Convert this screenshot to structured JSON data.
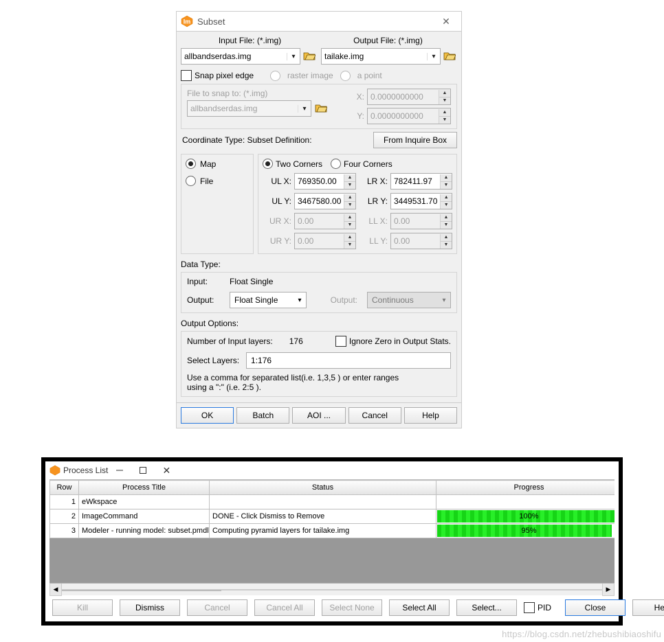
{
  "subset": {
    "title": "Subset",
    "inputFile": {
      "label": "Input File: (*.img)",
      "value": "allbandserdas.img"
    },
    "outputFile": {
      "label": "Output File: (*.img)",
      "value": "tailake.img"
    },
    "snap": {
      "label": "Snap pixel edge",
      "options": {
        "raster": "raster image",
        "point": "a point"
      }
    },
    "snapFile": {
      "label": "File to snap to: (*.img)",
      "value": "allbandserdas.img"
    },
    "snapX": {
      "label": "X:",
      "value": "0.0000000000"
    },
    "snapY": {
      "label": "Y:",
      "value": "0.0000000000"
    },
    "coordLine": "Coordinate Type: Subset Definition:",
    "fromInquire": "From Inquire Box",
    "coordType": {
      "map": "Map",
      "file": "File"
    },
    "cornerMode": {
      "two": "Two Corners",
      "four": "Four Corners"
    },
    "coords": {
      "ulx": {
        "label": "UL X:",
        "value": "769350.00"
      },
      "lrx": {
        "label": "LR X:",
        "value": "782411.97"
      },
      "uly": {
        "label": "UL Y:",
        "value": "3467580.00"
      },
      "lry": {
        "label": "LR Y:",
        "value": "3449531.70"
      },
      "urx": {
        "label": "UR X:",
        "value": "0.00"
      },
      "llx": {
        "label": "LL X:",
        "value": "0.00"
      },
      "ury": {
        "label": "UR Y:",
        "value": "0.00"
      },
      "lly": {
        "label": "LL Y:",
        "value": "0.00"
      }
    },
    "dataType": {
      "header": "Data Type:",
      "inputLabel": "Input:",
      "inputValue": "Float Single",
      "outputLabel": "Output:",
      "outputValue": "Float Single",
      "output2Label": "Output:",
      "output2Value": "Continuous"
    },
    "outputOptions": {
      "header": "Output Options:",
      "numLayersLabel": "Number of Input layers:",
      "numLayersValue": "176",
      "ignoreZero": "Ignore Zero in Output Stats.",
      "selectLayersLabel": "Select Layers:",
      "selectLayersValue": "1:176",
      "hint1": "Use a comma for separated list(i.e. 1,3,5 ) or enter ranges",
      "hint2": "using a \":\" (i.e. 2:5 )."
    },
    "buttons": {
      "ok": "OK",
      "batch": "Batch",
      "aoi": "AOI ...",
      "cancel": "Cancel",
      "help": "Help"
    }
  },
  "procList": {
    "title": "Process List",
    "columns": {
      "row": "Row",
      "title": "Process Title",
      "status": "Status",
      "progress": "Progress"
    },
    "rows": [
      {
        "n": "1",
        "title": "eWkspace",
        "status": "",
        "progress": null,
        "progressLabel": ""
      },
      {
        "n": "2",
        "title": "ImageCommand",
        "status": "DONE - Click Dismiss to Remove",
        "progress": 100,
        "progressLabel": "100%"
      },
      {
        "n": "3",
        "title": "Modeler - running model: subset.pmdl",
        "status": "Computing pyramid layers for tailake.img",
        "progress": 95,
        "progressLabel": "95%"
      }
    ],
    "buttons": {
      "kill": "Kill",
      "dismiss": "Dismiss",
      "cancel": "Cancel",
      "cancelAll": "Cancel All",
      "selectNone": "Select None",
      "selectAll": "Select All",
      "select": "Select...",
      "pid": "PID",
      "close": "Close",
      "help": "Help"
    }
  },
  "watermark": "https://blog.csdn.net/zhebushibiaoshifu"
}
